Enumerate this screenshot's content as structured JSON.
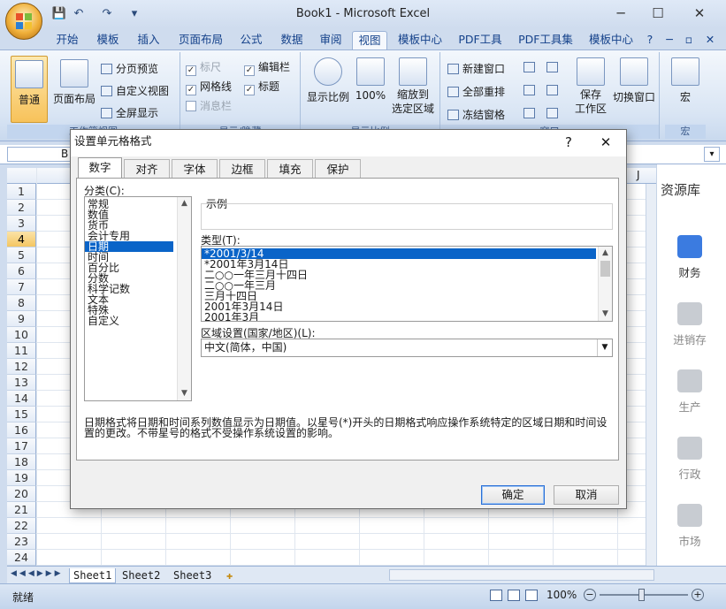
{
  "window": {
    "title": "Book1 - Microsoft Excel",
    "minimize": "─",
    "maximize": "☐",
    "close": "✕"
  },
  "qat": {
    "save": "💾",
    "undo": "↶",
    "redo": "↷",
    "more": "▾"
  },
  "ribbon_tabs": [
    "开始",
    "模板",
    "插入",
    "页面布局",
    "公式",
    "数据",
    "审阅",
    "视图",
    "模板中心",
    "PDF工具",
    "PDF工具集",
    "模板中心"
  ],
  "ribbon_right": {
    "help": "?",
    "min": "─",
    "restore": "▫",
    "close": "✕"
  },
  "ribbon": {
    "workbook_views": {
      "normal": "普通",
      "page_layout": "页面布局",
      "page_break": "分页预览",
      "custom_views": "自定义视图",
      "full_screen": "全屏显示",
      "label": "工作簿视图"
    },
    "show_hide": {
      "ruler": "标尺",
      "gridlines": "网格线",
      "message_bar": "消息栏",
      "formula_bar": "编辑栏",
      "headings": "标题",
      "label": "显示/隐藏"
    },
    "zoom": {
      "zoom": "显示比例",
      "hundred": "100%",
      "zoom_to_selection_1": "缩放到",
      "zoom_to_selection_2": "选定区域",
      "label": "显示比例"
    },
    "window": {
      "new_window": "新建窗口",
      "arrange_all": "全部重排",
      "freeze_panes": "冻结窗格",
      "save_workspace_1": "保存",
      "save_workspace_2": "工作区",
      "switch_windows": "切换窗口",
      "label": "窗口"
    },
    "macros": {
      "macro": "宏",
      "label": "宏"
    }
  },
  "name_box": "B",
  "col_a": "A",
  "col_j": "J",
  "rows": [
    "1",
    "2",
    "3",
    "4",
    "5",
    "6",
    "7",
    "8",
    "9",
    "10",
    "11",
    "12",
    "13",
    "14",
    "15",
    "16",
    "17",
    "18",
    "19",
    "20",
    "21",
    "22",
    "23",
    "24"
  ],
  "selected_row": "4",
  "right_panel": {
    "title": "资源库",
    "items": [
      "财务",
      "进销存",
      "生产",
      "行政",
      "市场"
    ]
  },
  "sheets": [
    "Sheet1",
    "Sheet2",
    "Sheet3"
  ],
  "status": {
    "ready": "就绪",
    "zoom": "100%"
  },
  "dialog": {
    "title": "设置单元格格式",
    "help": "?",
    "close": "✕",
    "tabs": [
      "数字",
      "对齐",
      "字体",
      "边框",
      "填充",
      "保护"
    ],
    "category_label": "分类(C):",
    "categories": [
      "常规",
      "数值",
      "货币",
      "会计专用",
      "日期",
      "时间",
      "百分比",
      "分数",
      "科学记数",
      "文本",
      "特殊",
      "自定义"
    ],
    "selected_category": "日期",
    "sample_label": "示例",
    "type_label": "类型(T):",
    "types": [
      "*2001/3/14",
      "*2001年3月14日",
      "二○○一年三月十四日",
      "二○○一年三月",
      "三月十四日",
      "2001年3月14日",
      "2001年3月"
    ],
    "locale_label": "区域设置(国家/地区)(L):",
    "locale_value": "中文(简体，中国)",
    "description": "日期格式将日期和时间系列数值显示为日期值。以星号(*)开头的日期格式响应操作系统特定的区域日期和时间设置的更改。不带星号的格式不受操作系统设置的影响。",
    "ok": "确定",
    "cancel": "取消"
  },
  "colors": {
    "accent": "#0a64c8",
    "ribbon": "#d9e5f4",
    "selected_row": "#f4c662"
  }
}
